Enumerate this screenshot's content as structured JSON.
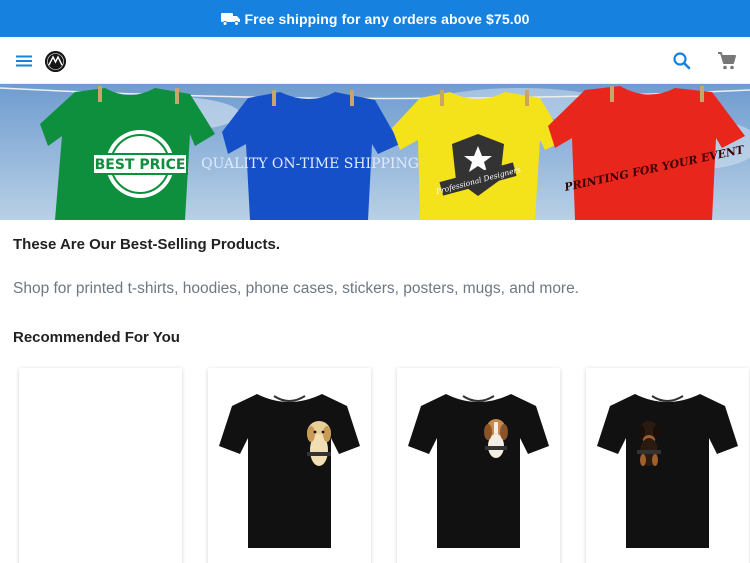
{
  "promo": {
    "icon": "truck-icon",
    "text": "Free shipping for any orders above $75.00",
    "color": "#1681de"
  },
  "header": {
    "menu_icon": "menu-icon",
    "logo": "logo",
    "search_icon": "search-icon",
    "cart_icon": "cart-icon"
  },
  "hero": {
    "shirts": [
      {
        "color": "#0d8f3d",
        "label": "BEST PRICE"
      },
      {
        "color": "#1650c8",
        "label": "QUALITY ON-TIME SHIPPING"
      },
      {
        "color": "#f4e21a",
        "label": "Professional Designers"
      },
      {
        "color": "#e8261c",
        "label": "PRINTING FOR YOUR EVENT"
      }
    ]
  },
  "content": {
    "headline": "These Are Our Best-Selling Products.",
    "subline": "Shop for printed t-shirts, hoodies, phone cases, stickers, posters, mugs, and more.",
    "section_title": "Recommended For You"
  },
  "products": [
    {
      "image": "placeholder"
    },
    {
      "image": "black-tshirt-golden-puppy"
    },
    {
      "image": "black-tshirt-beagle-puppy"
    },
    {
      "image": "black-tshirt-rottweiler-puppy"
    }
  ]
}
